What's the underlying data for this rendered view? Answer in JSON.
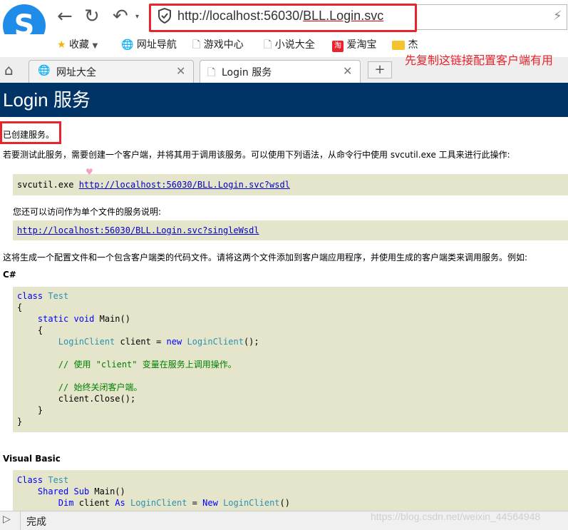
{
  "toolbar": {
    "back_icon": "left-arrow-icon",
    "refresh_icon": "refresh-icon",
    "undo_icon": "undo-icon",
    "url_host": "http://localhost:56030/",
    "url_path": "BLL.Login.svc",
    "bolt_icon": "lightning-icon"
  },
  "bookmarks": [
    {
      "label": "收藏",
      "icon": "star-icon"
    },
    {
      "label": "网址导航",
      "icon": "globe-icon"
    },
    {
      "label": "游戏中心",
      "icon": "page-icon"
    },
    {
      "label": "小说大全",
      "icon": "page-icon"
    },
    {
      "label": "爱淘宝",
      "icon": "taobao-icon"
    },
    {
      "label": "杰",
      "icon": "folder-icon"
    }
  ],
  "tabs": [
    {
      "label": "网址大全",
      "icon": "globe-icon"
    },
    {
      "label": "Login 服务",
      "icon": "page-icon"
    }
  ],
  "annotation": "先复制这链接配置客户端有用",
  "content": {
    "title": "Login 服务",
    "created": "已创建服务。",
    "intro": "若要测试此服务，需要创建一个客户端，并将其用于调用该服务。可以使用下列语法，从命令行中使用 svcutil.exe 工具来进行此操作:",
    "svcutil_cmd": "svcutil.exe ",
    "wsdl_link": "http://localhost:56030/BLL.Login.svc?wsdl",
    "single_intro": "您还可以访问作为单个文件的服务说明:",
    "single_link": "http://localhost:56030/BLL.Login.svc?singleWsdl",
    "generate_text": "这将生成一个配置文件和一个包含客户端类的代码文件。请将这两个文件添加到客户端应用程序，并使用生成的客户端类来调用服务。例如:",
    "csharp_label": "C#",
    "vb_label": "Visual Basic"
  },
  "status": {
    "text": "完成",
    "watermark": "https://blog.csdn.net/weixin_44564948"
  }
}
